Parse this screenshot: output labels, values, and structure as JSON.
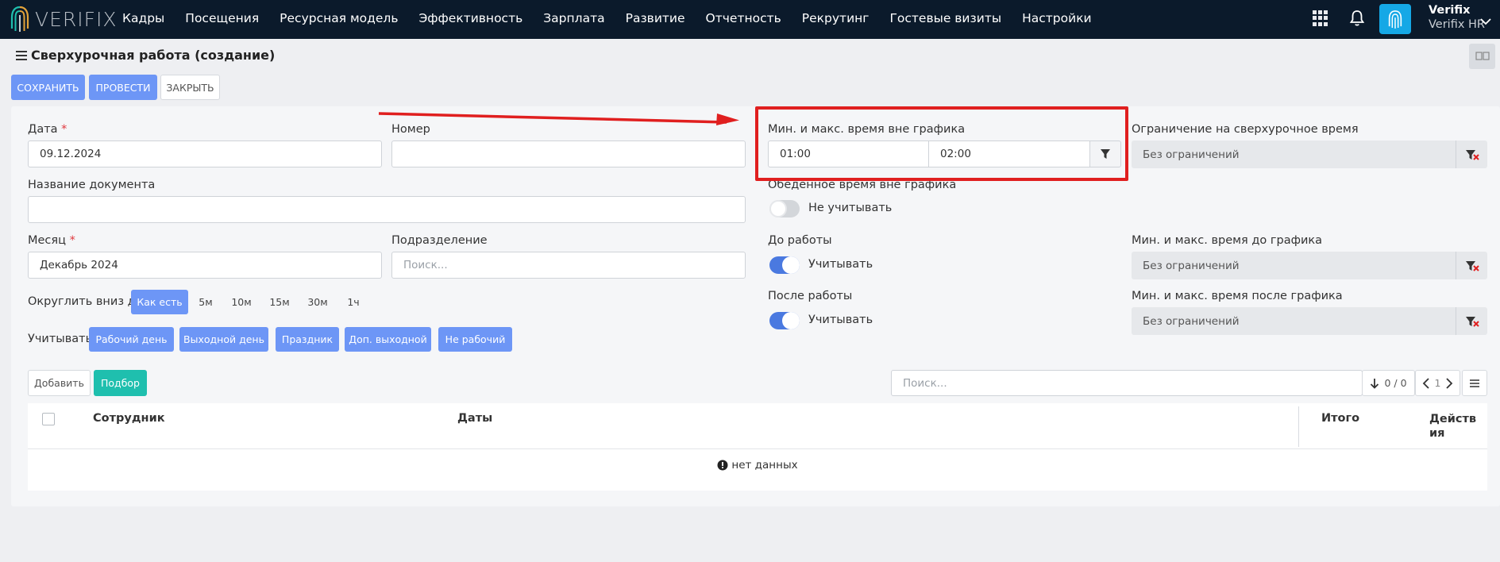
{
  "brand": {
    "logo_text": "VERIFIX"
  },
  "nav": [
    "Кадры",
    "Посещения",
    "Ресурсная модель",
    "Эффективность",
    "Зарплата",
    "Развитие",
    "Отчетность",
    "Рекрутинг",
    "Гостевые визиты",
    "Настройки"
  ],
  "user": {
    "name": "Verifix",
    "org": "Verifix HR"
  },
  "page": {
    "title": "Сверхурочная работа (создание)"
  },
  "actions": {
    "save": "СОХРАНИТЬ",
    "post": "ПРОВЕСТИ",
    "close": "ЗАКРЫТЬ"
  },
  "form": {
    "date": {
      "label": "Дата",
      "required": "*",
      "value": "09.12.2024"
    },
    "number": {
      "label": "Номер",
      "value": ""
    },
    "doc_name": {
      "label": "Название документа",
      "value": ""
    },
    "month": {
      "label": "Месяц",
      "required": "*",
      "value": "Декабрь 2024"
    },
    "division": {
      "label": "Подразделение",
      "placeholder": "Поиск..."
    },
    "round_down": {
      "label": "Округлить вниз до:",
      "options": [
        "Как есть",
        "5м",
        "10м",
        "15м",
        "30м",
        "1ч"
      ],
      "selected": "Как есть"
    },
    "consider": {
      "label": "Учитывать:",
      "options": [
        "Рабочий день",
        "Выходной день",
        "Праздник",
        "Доп. выходной",
        "Не рабочий"
      ]
    },
    "min_max_off_schedule": {
      "label": "Мин. и макс. время вне графика",
      "min": "01:00",
      "max": "02:00"
    },
    "overtime_limit": {
      "label": "Ограничение на сверхурочное время",
      "value": "Без ограничений"
    },
    "lunch_off_schedule": {
      "label": "Обеденное время вне графика",
      "toggle_text": "Не учитывать",
      "on": false
    },
    "before_work": {
      "label": "До работы",
      "toggle_text": "Учитывать",
      "on": true
    },
    "before_limit": {
      "label": "Мин. и макс. время до графика",
      "value": "Без ограничений"
    },
    "after_work": {
      "label": "После работы",
      "toggle_text": "Учитывать",
      "on": true
    },
    "after_limit": {
      "label": "Мин. и макс. время после графика",
      "value": "Без ограничений"
    }
  },
  "grid_toolbar": {
    "add": "Добавить",
    "pick": "Подбор",
    "search_placeholder": "Поиск...",
    "count": "0 / 0",
    "page": "1"
  },
  "table": {
    "columns": [
      "Сотрудник",
      "Даты",
      "Итого",
      "Действ\nия"
    ],
    "empty": "нет данных"
  },
  "colors": {
    "topbar": "#0b1a2b",
    "primary": "#6d96f6",
    "accent": "#1fbfae",
    "highlight": "#e01f1f"
  }
}
